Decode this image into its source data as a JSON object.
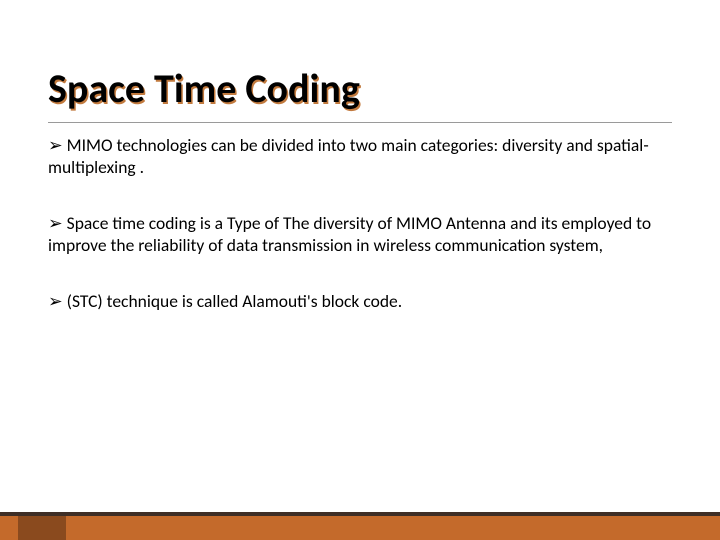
{
  "slide": {
    "title": "Space Time Coding",
    "bullets": [
      "MIMO technologies can be divided into two main categories: diversity and spatial-multiplexing .",
      "Space time coding is a Type of The diversity of MIMO Antenna and its employed to improve the reliability of data transmission in wireless communication system,",
      "(STC) technique is called Alamouti's block code."
    ],
    "bullet_glyph": "➢",
    "colors": {
      "accent": "#c46a2b",
      "accent_dark": "#8a4a1e",
      "strip": "#3e2e26",
      "title_shadow": "#c27a3e"
    }
  }
}
